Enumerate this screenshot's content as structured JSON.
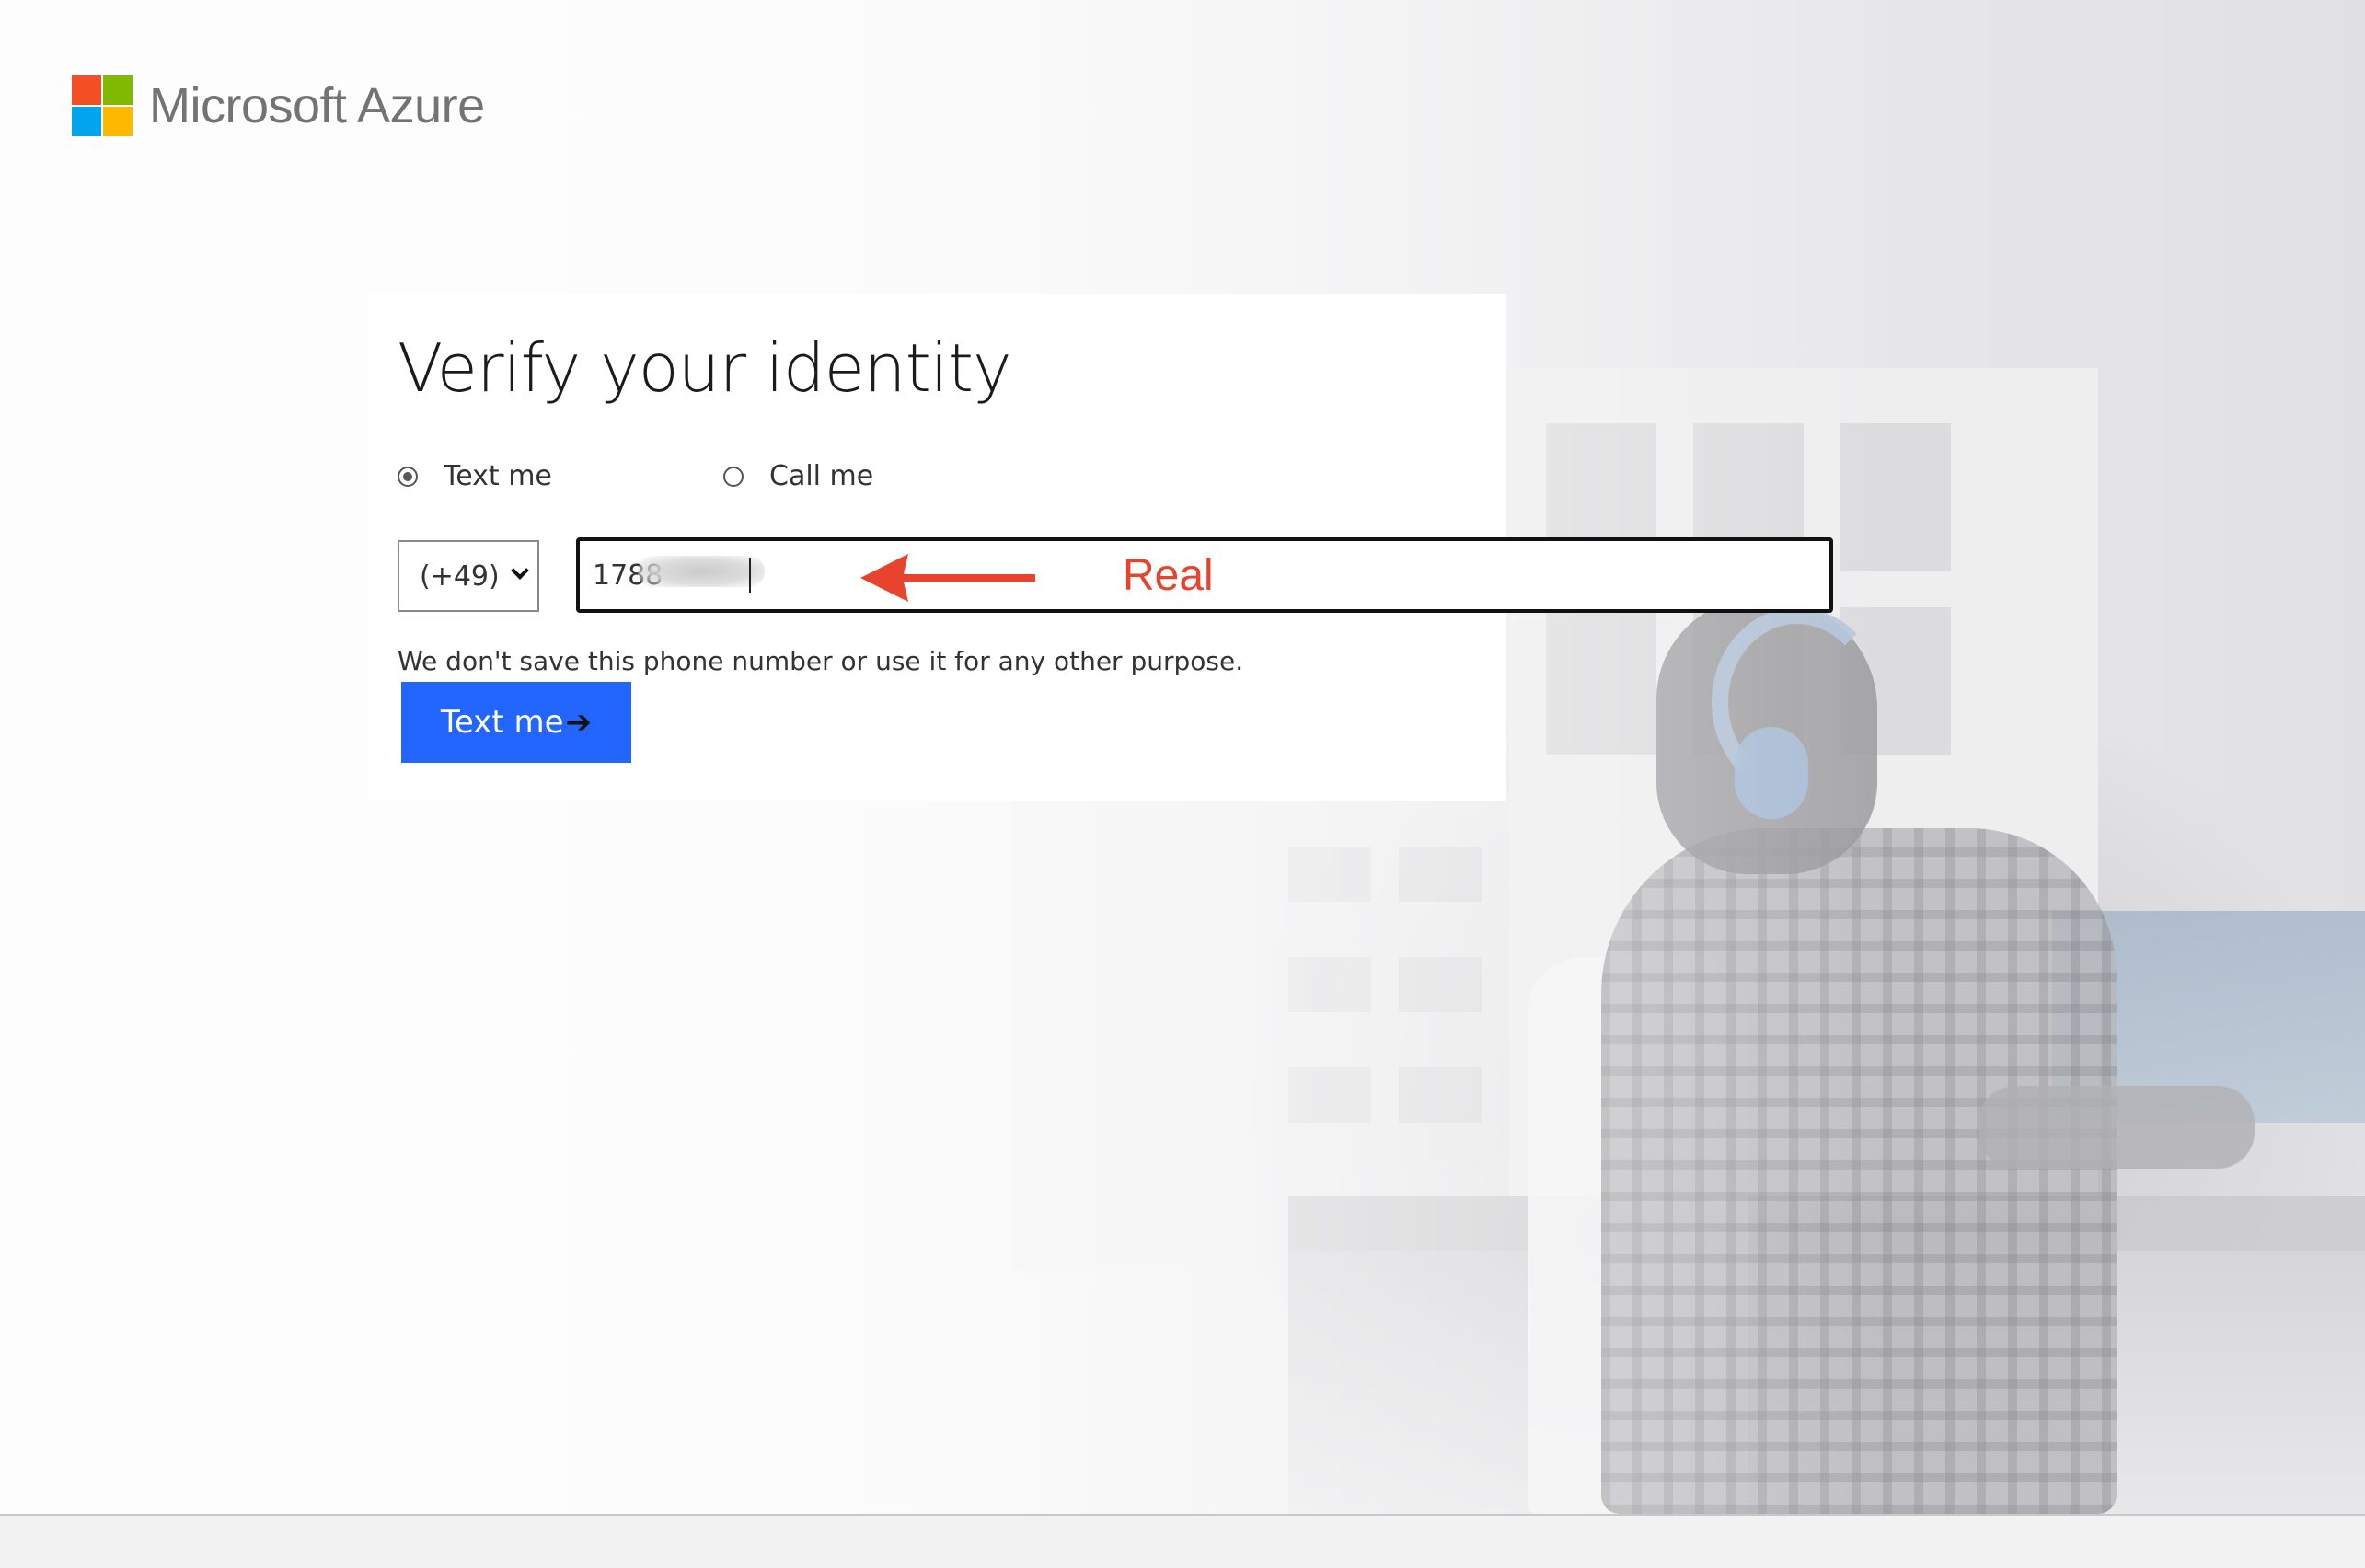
{
  "brand": {
    "name": "Microsoft Azure",
    "logo_colors": [
      "#f25022",
      "#7fba00",
      "#00a4ef",
      "#ffb900"
    ]
  },
  "card": {
    "title": "Verify your identity",
    "options": [
      {
        "label": "Text me",
        "selected": true
      },
      {
        "label": "Call me",
        "selected": false
      }
    ],
    "country_code": {
      "selected": "(+49)"
    },
    "phone_input": {
      "value": "1788"
    },
    "disclaimer": "We don't save this phone number or use it for any other purpose.",
    "submit_label": "Text me",
    "submit_icon": "arrow-right-icon",
    "accent_color": "#2266ff"
  },
  "annotation": {
    "label": "Real",
    "color": "#e8432d"
  }
}
